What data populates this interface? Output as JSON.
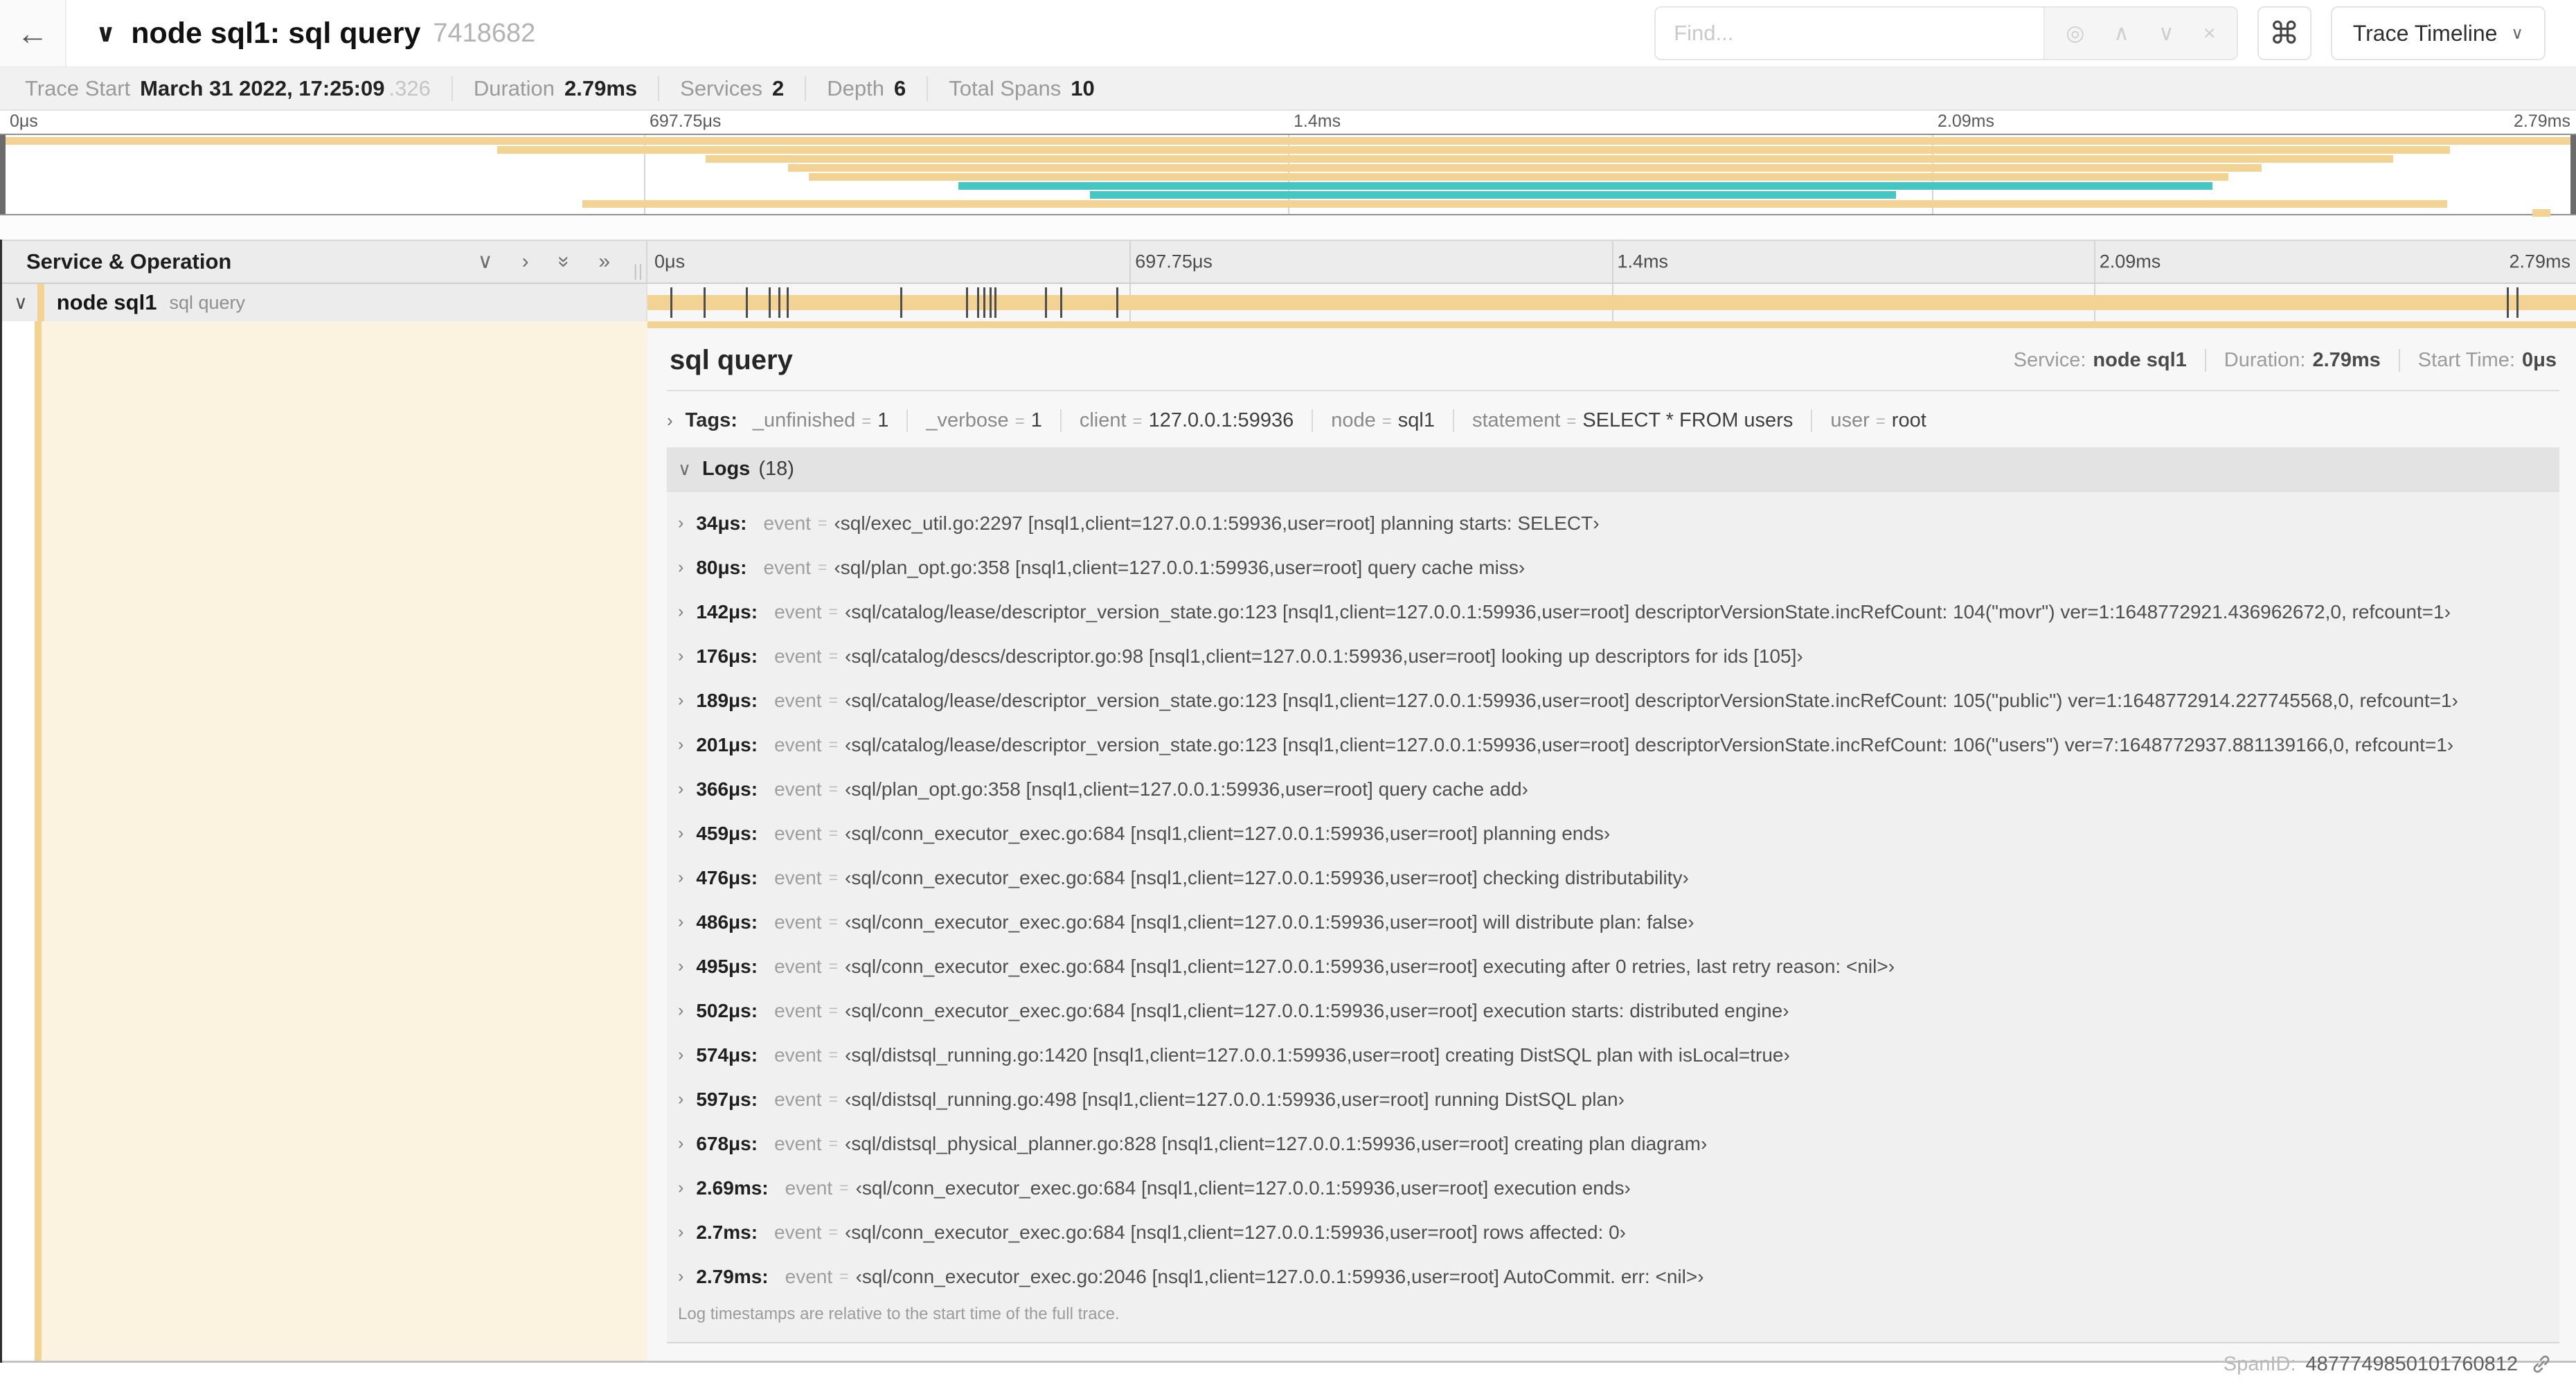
{
  "colors": {
    "span_tan": "#F2D394",
    "span_teal": "#45C6C3",
    "detail_cream": "#FBF3E0"
  },
  "topbar": {
    "back_icon": "←",
    "collapse_icon": "∨",
    "title": "node sql1: sql query",
    "trace_id": "7418682",
    "find_placeholder": "Find...",
    "find_icons": [
      {
        "name": "locate-icon",
        "glyph": "◎"
      },
      {
        "name": "prev-result-icon",
        "glyph": "∧"
      },
      {
        "name": "next-result-icon",
        "glyph": "∨"
      },
      {
        "name": "clear-search-icon",
        "glyph": "×"
      }
    ],
    "shortcut_icon": "⌘",
    "view_selector_label": "Trace Timeline",
    "view_selector_chevron": "∨"
  },
  "trace_info": {
    "items": [
      {
        "label": "Trace Start",
        "value": "March 31 2022, 17:25:09",
        "suffix": ".326"
      },
      {
        "label": "Duration",
        "value": "2.79ms"
      },
      {
        "label": "Services",
        "value": "2"
      },
      {
        "label": "Depth",
        "value": "6"
      },
      {
        "label": "Total Spans",
        "value": "10"
      }
    ]
  },
  "timeline": {
    "left_header": "Service & Operation",
    "ops_icons": [
      {
        "name": "collapse-one-icon",
        "glyph": "∨",
        "rotate": false
      },
      {
        "name": "expand-one-icon",
        "glyph": "›",
        "rotate": false
      },
      {
        "name": "collapse-all-icon",
        "glyph": "»",
        "rotate": true
      },
      {
        "name": "expand-all-icon",
        "glyph": "»",
        "rotate": false
      }
    ],
    "grip": "||",
    "tick_labels": [
      "0μs",
      "697.75μs",
      "1.4ms",
      "2.09ms",
      "2.79ms"
    ],
    "tick_positions_pct": [
      0,
      25,
      50,
      75,
      100
    ]
  },
  "minimap": {
    "rows": [
      {
        "start": 0,
        "end": 100,
        "color": "tan"
      },
      {
        "start": 19.3,
        "end": 95.1,
        "color": "tan"
      },
      {
        "start": 27.4,
        "end": 92.9,
        "color": "tan"
      },
      {
        "start": 30.6,
        "end": 87.8,
        "color": "tan"
      },
      {
        "start": 31.4,
        "end": 86.5,
        "color": "tan"
      },
      {
        "start": 37.2,
        "end": 85.9,
        "color": "teal"
      },
      {
        "start": 42.3,
        "end": 73.6,
        "color": "teal"
      },
      {
        "start": 22.6,
        "end": 95.0,
        "color": "tan"
      },
      {
        "start": 98.3,
        "end": 99.0,
        "color": "tan"
      }
    ]
  },
  "span_row": {
    "collapse_icon": "∨",
    "service": "node sql1",
    "operation": "sql query",
    "log_marker_positions_pct": [
      1.2,
      2.9,
      5.1,
      6.3,
      6.8,
      7.2,
      13.1,
      16.5,
      17.1,
      17.4,
      17.75,
      18.0,
      20.6,
      21.4,
      24.3,
      96.4,
      96.9
    ]
  },
  "detail": {
    "title": "sql query",
    "meta": [
      {
        "label": "Service:",
        "value": "node sql1"
      },
      {
        "label": "Duration:",
        "value": "2.79ms"
      },
      {
        "label": "Start Time:",
        "value": "0μs"
      }
    ],
    "tags_chevron": "›",
    "tags_label": "Tags:",
    "tags": [
      {
        "key": "_unfinished",
        "value": "1"
      },
      {
        "key": "_verbose",
        "value": "1"
      },
      {
        "key": "client",
        "value": "127.0.0.1:59936"
      },
      {
        "key": "node",
        "value": "sql1"
      },
      {
        "key": "statement",
        "value": "SELECT * FROM users"
      },
      {
        "key": "user",
        "value": "root"
      }
    ],
    "logs_chevron": "∨",
    "logs_label": "Logs",
    "logs_count": "(18)",
    "log_field_key": "event",
    "logs": [
      {
        "time": "34μs:",
        "message": "‹sql/exec_util.go:2297 [nsql1,client=127.0.0.1:59936,user=root] planning starts: SELECT›"
      },
      {
        "time": "80μs:",
        "message": "‹sql/plan_opt.go:358 [nsql1,client=127.0.0.1:59936,user=root] query cache miss›"
      },
      {
        "time": "142μs:",
        "message": "‹sql/catalog/lease/descriptor_version_state.go:123 [nsql1,client=127.0.0.1:59936,user=root] descriptorVersionState.incRefCount: 104(\"movr\") ver=1:1648772921.436962672,0, refcount=1›"
      },
      {
        "time": "176μs:",
        "message": "‹sql/catalog/descs/descriptor.go:98 [nsql1,client=127.0.0.1:59936,user=root] looking up descriptors for ids [105]›"
      },
      {
        "time": "189μs:",
        "message": "‹sql/catalog/lease/descriptor_version_state.go:123 [nsql1,client=127.0.0.1:59936,user=root] descriptorVersionState.incRefCount: 105(\"public\") ver=1:1648772914.227745568,0, refcount=1›"
      },
      {
        "time": "201μs:",
        "message": "‹sql/catalog/lease/descriptor_version_state.go:123 [nsql1,client=127.0.0.1:59936,user=root] descriptorVersionState.incRefCount: 106(\"users\") ver=7:1648772937.881139166,0, refcount=1›"
      },
      {
        "time": "366μs:",
        "message": "‹sql/plan_opt.go:358 [nsql1,client=127.0.0.1:59936,user=root] query cache add›"
      },
      {
        "time": "459μs:",
        "message": "‹sql/conn_executor_exec.go:684 [nsql1,client=127.0.0.1:59936,user=root] planning ends›"
      },
      {
        "time": "476μs:",
        "message": "‹sql/conn_executor_exec.go:684 [nsql1,client=127.0.0.1:59936,user=root] checking distributability›"
      },
      {
        "time": "486μs:",
        "message": "‹sql/conn_executor_exec.go:684 [nsql1,client=127.0.0.1:59936,user=root] will distribute plan: false›"
      },
      {
        "time": "495μs:",
        "message": "‹sql/conn_executor_exec.go:684 [nsql1,client=127.0.0.1:59936,user=root] executing after 0 retries, last retry reason: <nil>›"
      },
      {
        "time": "502μs:",
        "message": "‹sql/conn_executor_exec.go:684 [nsql1,client=127.0.0.1:59936,user=root] execution starts: distributed engine›"
      },
      {
        "time": "574μs:",
        "message": "‹sql/distsql_running.go:1420 [nsql1,client=127.0.0.1:59936,user=root] creating DistSQL plan with isLocal=true›"
      },
      {
        "time": "597μs:",
        "message": "‹sql/distsql_running.go:498 [nsql1,client=127.0.0.1:59936,user=root] running DistSQL plan›"
      },
      {
        "time": "678μs:",
        "message": "‹sql/distsql_physical_planner.go:828 [nsql1,client=127.0.0.1:59936,user=root] creating plan diagram›"
      },
      {
        "time": "2.69ms:",
        "message": "‹sql/conn_executor_exec.go:684 [nsql1,client=127.0.0.1:59936,user=root] execution ends›"
      },
      {
        "time": "2.7ms:",
        "message": "‹sql/conn_executor_exec.go:684 [nsql1,client=127.0.0.1:59936,user=root] rows affected: 0›"
      },
      {
        "time": "2.79ms:",
        "message": "‹sql/conn_executor_exec.go:2046 [nsql1,client=127.0.0.1:59936,user=root] AutoCommit. err: <nil>›"
      }
    ],
    "footer_note": "Log timestamps are relative to the start time of the full trace.",
    "span_id_label": "SpanID:",
    "span_id": "4877749850101760812"
  }
}
